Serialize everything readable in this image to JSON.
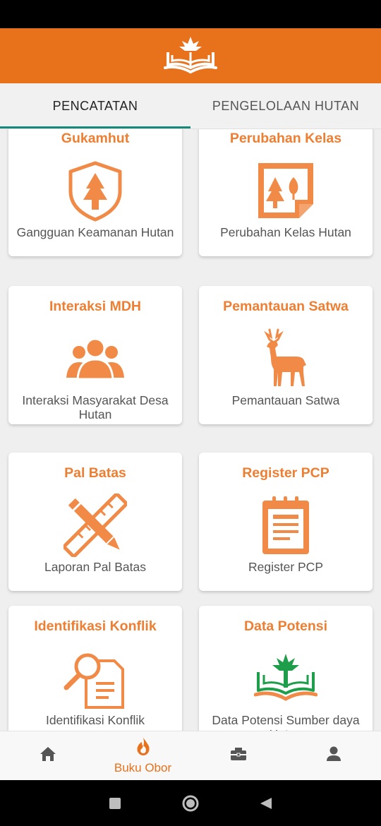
{
  "header": {
    "logo_icon": "book-tree-logo-icon"
  },
  "tabs": [
    {
      "label": "PENCATATAN",
      "active": true
    },
    {
      "label": "PENGELOLAAN HUTAN",
      "active": false
    }
  ],
  "cards": [
    {
      "title": "Gukamhut",
      "desc": "Gangguan Keamanan Hutan",
      "icon": "shield-tree-icon"
    },
    {
      "title": "Perubahan Kelas",
      "desc": "Perubahan Kelas Hutan",
      "icon": "forest-map-icon"
    },
    {
      "title": "Interaksi MDH",
      "desc": "Interaksi Masyarakat Desa Hutan",
      "icon": "people-group-icon"
    },
    {
      "title": "Pemantauan Satwa",
      "desc": "Pemantauan Satwa",
      "icon": "deer-icon"
    },
    {
      "title": "Pal Batas",
      "desc": "Laporan Pal Batas",
      "icon": "ruler-pencil-icon"
    },
    {
      "title": "Register PCP",
      "desc": "Register PCP",
      "icon": "notepad-icon"
    },
    {
      "title": "Identifikasi Konflik",
      "desc": "Identifikasi Konflik",
      "icon": "magnifier-document-icon"
    },
    {
      "title": "Data Potensi",
      "desc": "Data Potensi Sumber daya Hutan",
      "icon": "book-tree-icon"
    }
  ],
  "bottom_nav": [
    {
      "label": "",
      "icon": "home-icon"
    },
    {
      "label": "Buku Obor",
      "icon": "flame-icon",
      "active": true
    },
    {
      "label": "",
      "icon": "briefcase-icon"
    },
    {
      "label": "",
      "icon": "person-icon"
    }
  ],
  "colors": {
    "brand": "#E8711C",
    "accent": "#EE7E32",
    "tab_indicator": "#14897A"
  }
}
